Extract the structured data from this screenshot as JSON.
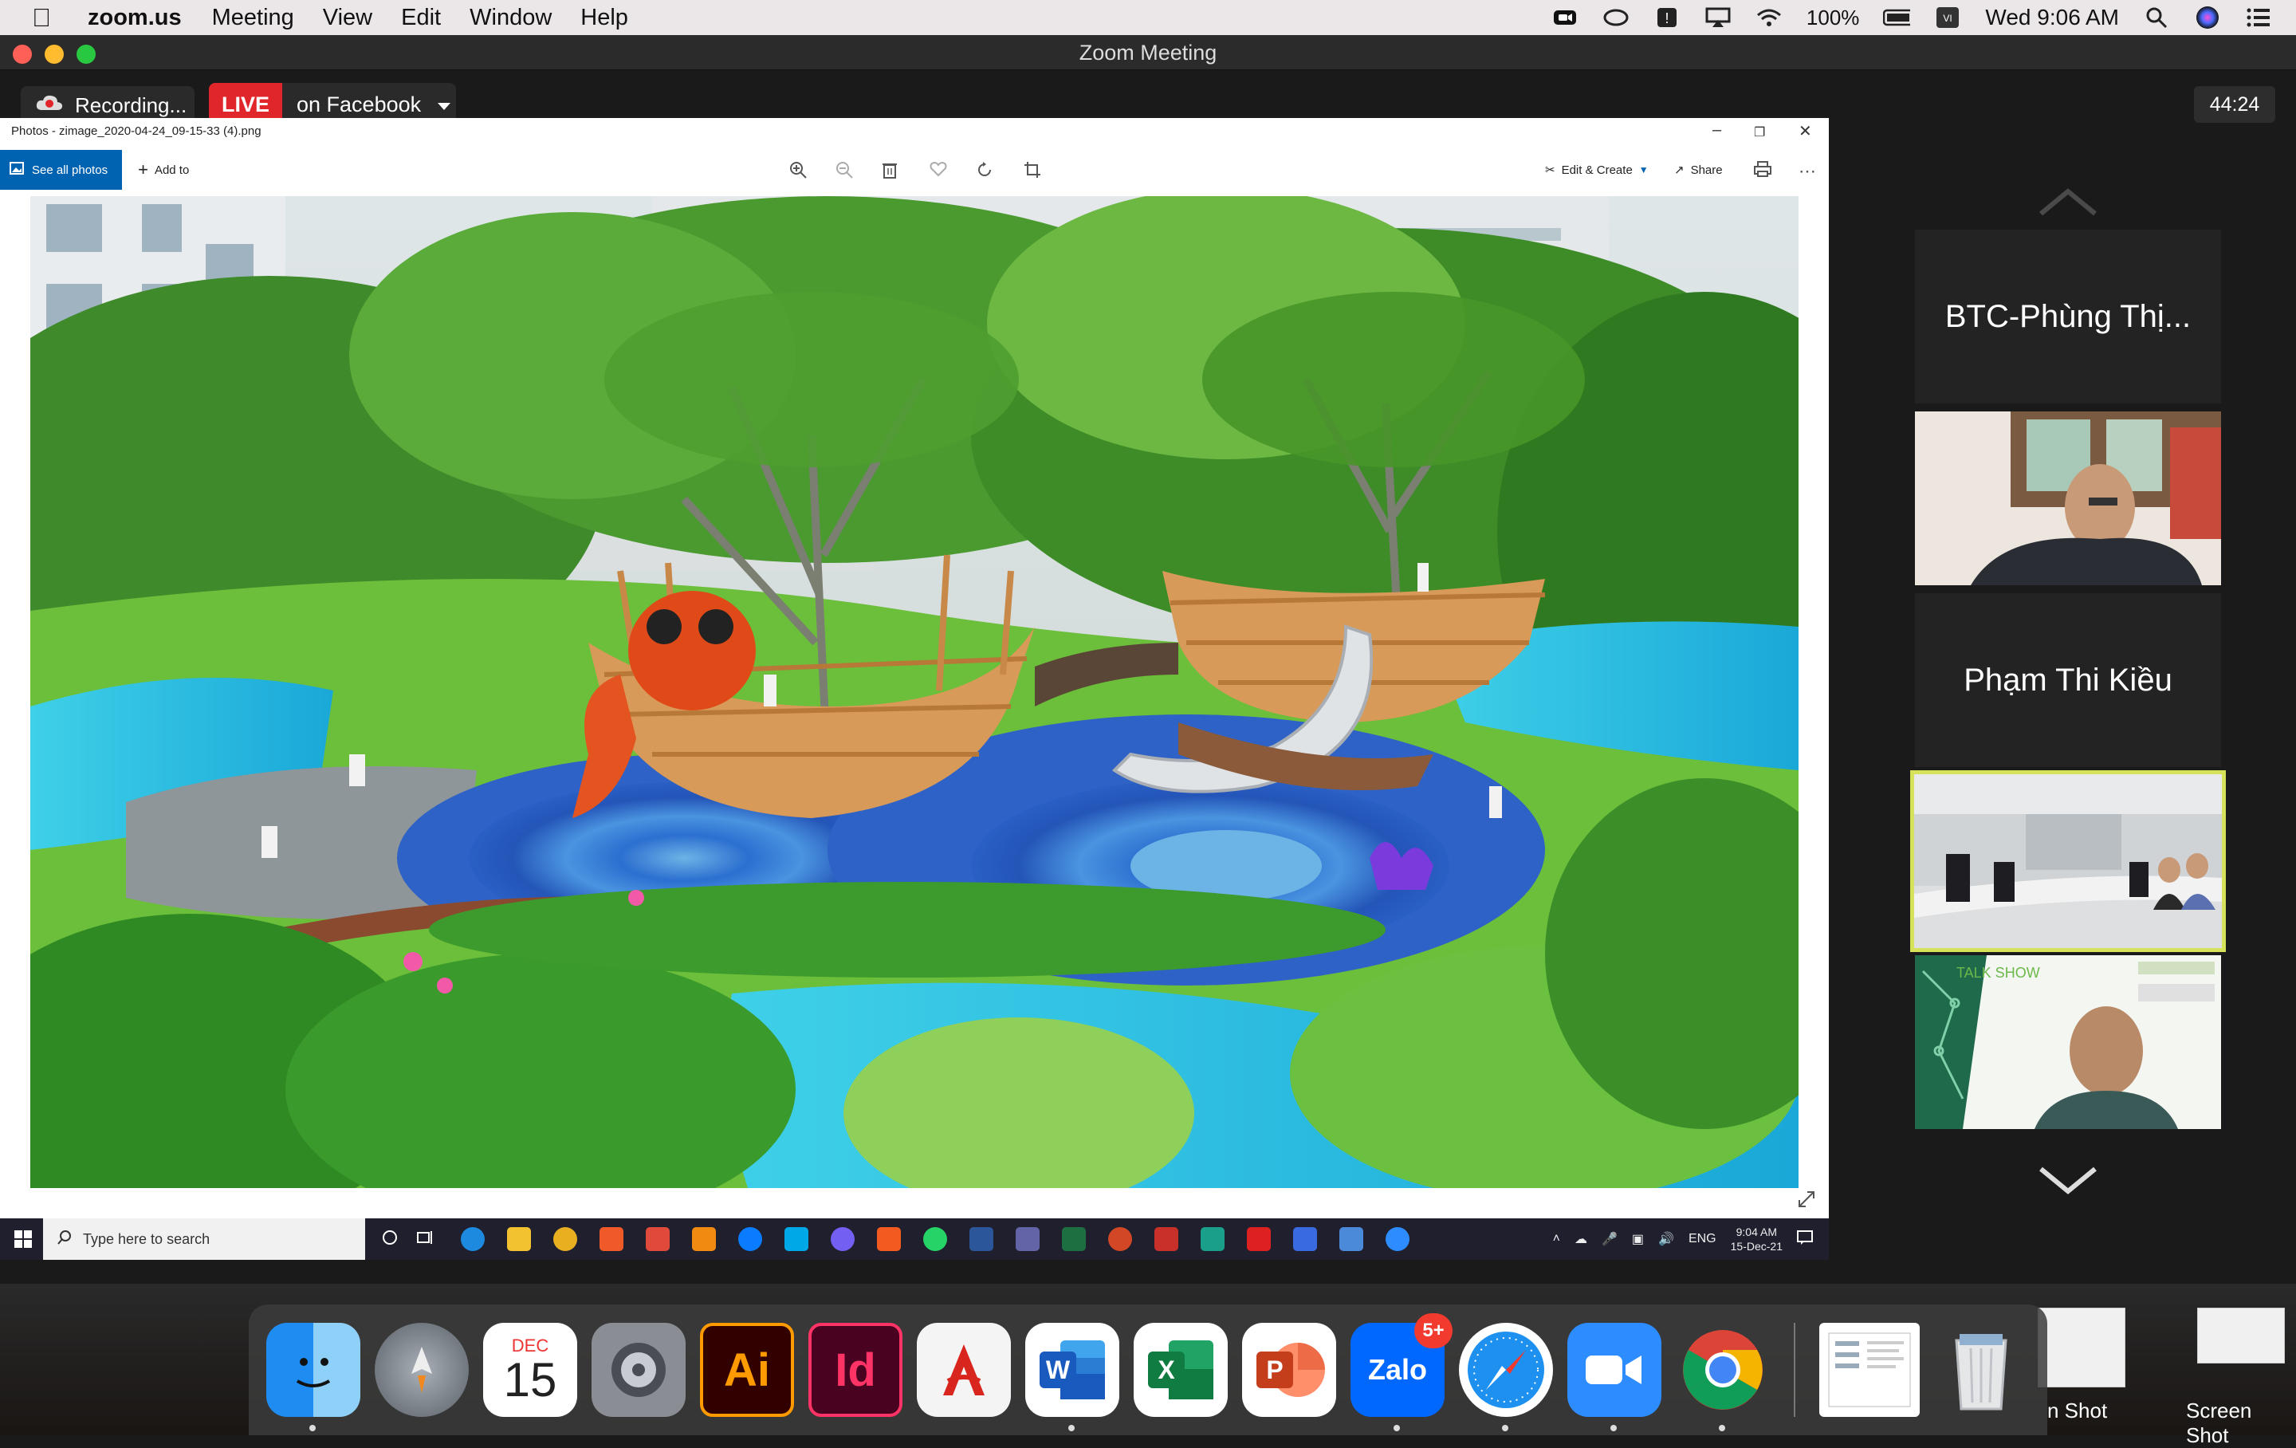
{
  "menubar": {
    "app_name": "zoom.us",
    "menus": [
      "Meeting",
      "View",
      "Edit",
      "Window",
      "Help"
    ],
    "battery": "100%",
    "datetime": "Wed 9:06 AM"
  },
  "window": {
    "title": "Zoom Meeting"
  },
  "meeting": {
    "recording_label": "Recording...",
    "live_badge": "LIVE",
    "live_target": "on Facebook",
    "timer": "44:24"
  },
  "photos": {
    "file_title": "Photos - zimage_2020-04-24_09-15-33 (4).png",
    "see_all": "See all photos",
    "add_to": "Add to",
    "edit_create": "Edit & Create",
    "share": "Share"
  },
  "win_taskbar": {
    "search_placeholder": "Type here to search",
    "lang": "ENG",
    "time": "9:04 AM",
    "date": "15-Dec-21"
  },
  "participants": [
    {
      "name": "BTC-Phùng Thị...",
      "type": "name-only"
    },
    {
      "name": "",
      "type": "video"
    },
    {
      "name": "Phạm Thi Kiều",
      "type": "name-only"
    },
    {
      "name": "",
      "type": "video-active"
    },
    {
      "name": "TALK SHOW",
      "type": "video"
    }
  ],
  "dock": {
    "calendar_month": "DEC",
    "calendar_day": "15",
    "zalo_badge": "5+",
    "apps": [
      "Finder",
      "Launchpad",
      "Calendar",
      "System Preferences",
      "Illustrator",
      "InDesign",
      "Acrobat",
      "Word",
      "Excel",
      "PowerPoint",
      "Zalo",
      "Safari",
      "Zoom",
      "Chrome",
      "Preview",
      "Trash"
    ],
    "illustrator_label": "Ai",
    "indesign_label": "Id",
    "zalo_label": "Zalo",
    "desktop_files": [
      "n Shot",
      "Screen Shot"
    ]
  },
  "colors": {
    "live_red": "#e0262b",
    "active_border": "#d6e35a",
    "photos_blue": "#0063b1"
  }
}
